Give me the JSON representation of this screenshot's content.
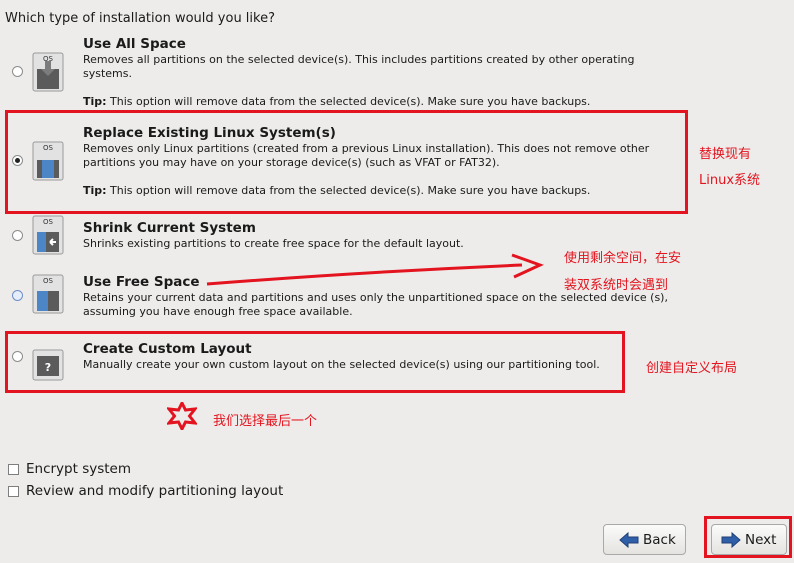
{
  "question": "Which type of installation would you like?",
  "options": [
    {
      "title": "Use All Space",
      "desc": "Removes all partitions on the selected device(s).  This includes partitions created by other operating systems.",
      "tip_label": "Tip:",
      "tip": " This option will remove data from the selected device(s).  Make sure you have backups.",
      "selected": false
    },
    {
      "title": "Replace Existing Linux System(s)",
      "desc": "Removes only Linux partitions (created from a previous Linux installation).  This does not remove other partitions you may have on your storage device(s) (such as VFAT or FAT32).",
      "tip_label": "Tip:",
      "tip": " This option will remove data from the selected device(s).  Make sure you have backups.",
      "selected": true
    },
    {
      "title": "Shrink Current System",
      "desc": "Shrinks existing partitions to create free space for the default layout.",
      "selected": false
    },
    {
      "title": "Use Free Space",
      "desc": "Retains your current data and partitions and uses only the unpartitioned space on the selected device (s), assuming you have enough free space available.",
      "selected": false
    },
    {
      "title": "Create Custom Layout",
      "desc": "Manually create your own custom layout on the selected device(s) using our partitioning tool.",
      "selected": false
    }
  ],
  "icon_label": "OS",
  "icon_question": "?",
  "annotations": {
    "replace_line1": "替换现有",
    "replace_line2": "Linux系统",
    "free_line1": "使用剩余空间，在安",
    "free_line2": "装双系统时会遇到",
    "custom": "创建自定义布局",
    "choice": "我们选择最后一个"
  },
  "checkboxes": [
    {
      "label": "Encrypt system",
      "checked": false
    },
    {
      "label": "Review and modify partitioning layout",
      "checked": false
    }
  ],
  "buttons": {
    "back": "Back",
    "next": "Next"
  },
  "colors": {
    "annotation_red": "#e3141f",
    "arrow_blue": "#2f5fa8",
    "background": "#edecea"
  }
}
